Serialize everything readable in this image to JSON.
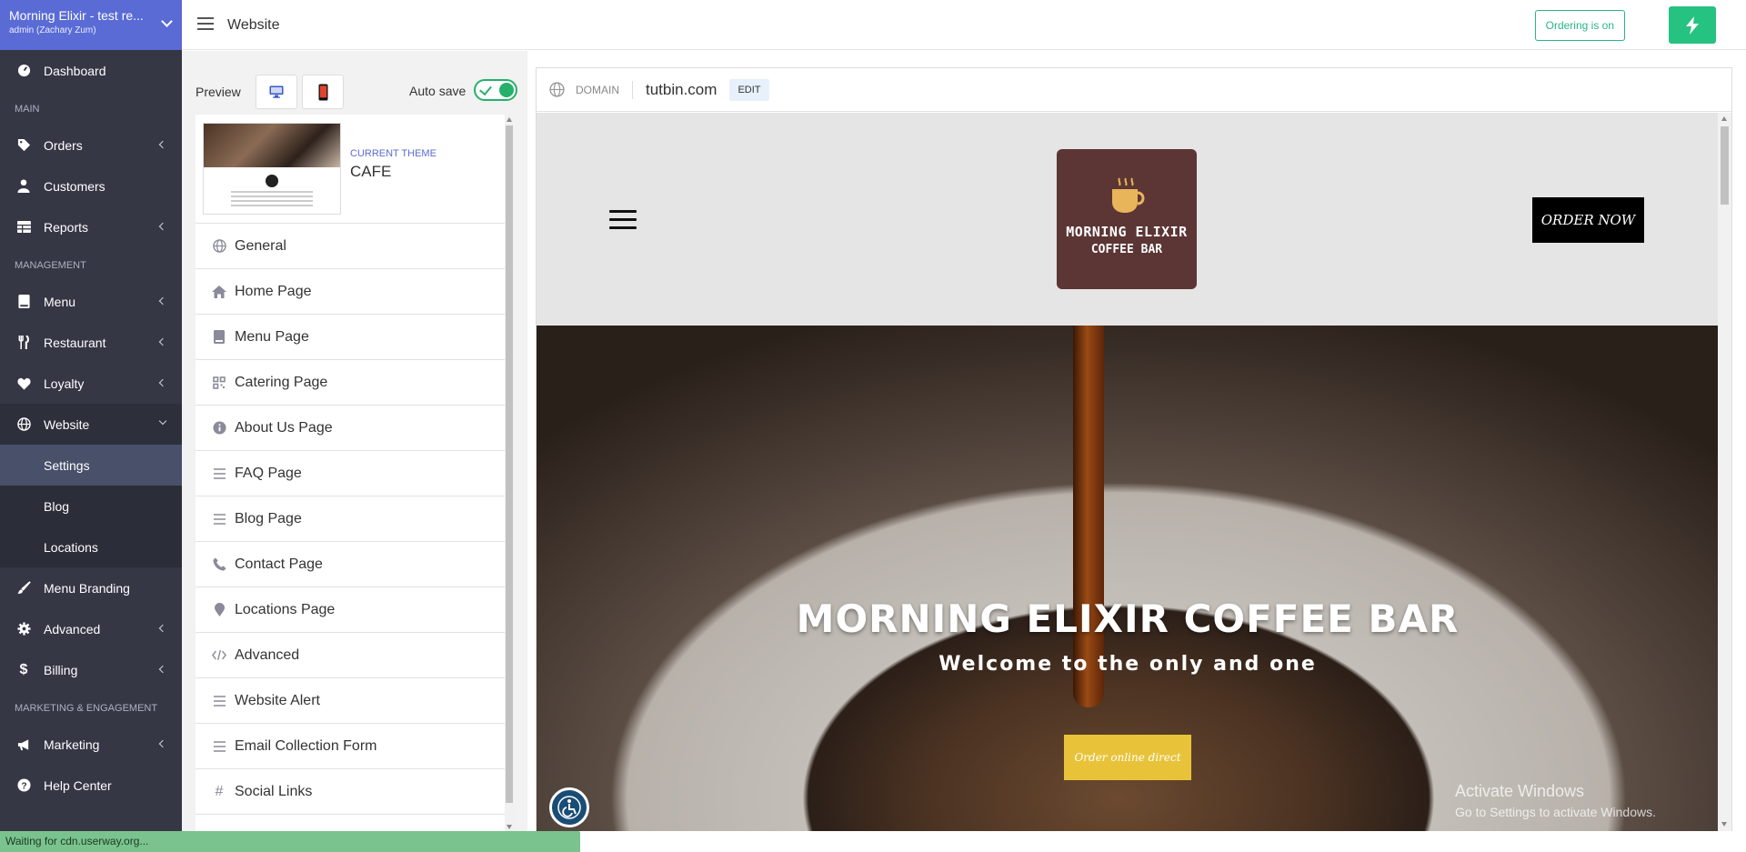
{
  "sidebar": {
    "brand_title": "Morning Elixir - test re...",
    "brand_sub": "admin (Zachary Zum)",
    "dashboard": "Dashboard",
    "section_main": "MAIN",
    "orders": "Orders",
    "customers": "Customers",
    "reports": "Reports",
    "section_management": "MANAGEMENT",
    "menu": "Menu",
    "restaurant": "Restaurant",
    "loyalty": "Loyalty",
    "website": "Website",
    "website_sub": [
      "Settings",
      "Blog",
      "Locations"
    ],
    "menu_branding": "Menu Branding",
    "advanced": "Advanced",
    "billing": "Billing",
    "section_marketing": "MARKETING & ENGAGEMENT",
    "marketing": "Marketing",
    "help_center": "Help Center"
  },
  "topbar": {
    "title": "Website",
    "ordering": "Ordering is on"
  },
  "panel": {
    "preview_label": "Preview",
    "autosave_label": "Auto save",
    "theme_caption": "CURRENT THEME",
    "theme_name": "CAFE",
    "items": [
      {
        "label": "General",
        "icon": "globe-icon"
      },
      {
        "label": "Home Page",
        "icon": "home-icon"
      },
      {
        "label": "Menu Page",
        "icon": "book-icon"
      },
      {
        "label": "Catering Page",
        "icon": "grid-icon"
      },
      {
        "label": "About Us Page",
        "icon": "info-icon"
      },
      {
        "label": "FAQ Page",
        "icon": "list-icon"
      },
      {
        "label": "Blog Page",
        "icon": "list-icon"
      },
      {
        "label": "Contact Page",
        "icon": "phone-icon"
      },
      {
        "label": "Locations Page",
        "icon": "map-pin-icon"
      },
      {
        "label": "Advanced",
        "icon": "code-icon"
      },
      {
        "label": "Website Alert",
        "icon": "list-icon"
      },
      {
        "label": "Email Collection Form",
        "icon": "list-icon"
      },
      {
        "label": "Social Links",
        "icon": "hash-icon"
      }
    ]
  },
  "preview": {
    "domain_label": "DOMAIN",
    "domain_value": "tutbin.com",
    "edit": "EDIT",
    "site": {
      "logo_line1": "MORNING ELIXIR",
      "logo_line2": "COFFEE BAR",
      "order_now": "ORDER NOW",
      "hero_title": "MORNING ELIXIR COFFEE BAR",
      "hero_subtitle": "Welcome to the only and one",
      "hero_button": "Order online direct",
      "watermark_title": "Activate Windows",
      "watermark_sub": "Go to Settings to activate Windows."
    }
  },
  "status": "Waiting for cdn.userway.org...",
  "colors": {
    "sidebar_bg": "#353745",
    "brand_bg": "#5a6bd5",
    "accent_green": "#26c281",
    "logo_bg": "#5c3535",
    "hero_button_bg": "#e8c33a"
  }
}
